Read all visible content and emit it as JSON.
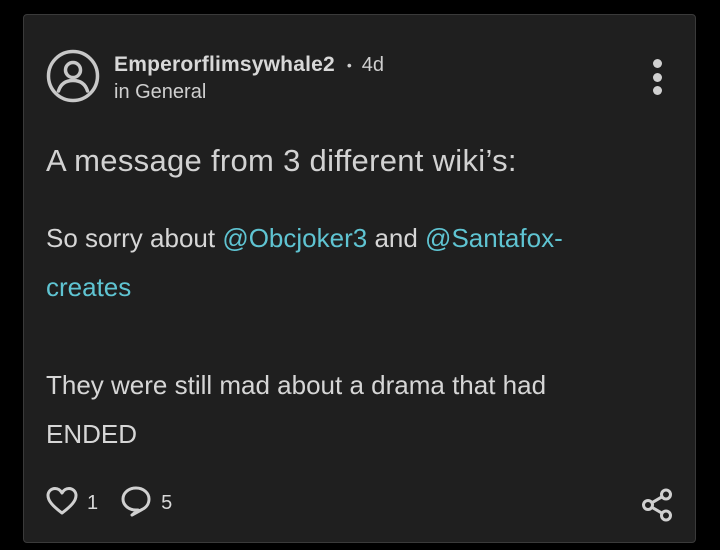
{
  "post": {
    "author": "Emperorflimsywhale2",
    "separator": "•",
    "time_ago": "4d",
    "community": "in General",
    "title": "A message from 3 different wiki’s:",
    "body": {
      "line1_prefix": "So sorry about ",
      "mention1": "@Obcjoker3",
      "line1_middle": " and ",
      "mention2_part1": "@Santafox-",
      "mention2_part2": "creates",
      "paragraph2_line1": "They were still mad about a drama that had",
      "paragraph2_line2": "ENDED"
    },
    "likes": "1",
    "comments": "5"
  },
  "icons": {
    "avatar": "user-circle-icon",
    "more": "more-vertical-icon",
    "like": "heart-icon",
    "comment": "comment-bubble-icon",
    "share": "share-icon"
  },
  "colors": {
    "background": "#000000",
    "card": "#1f1f1f",
    "text": "#d6d6d6",
    "mention": "#5fc4d2"
  }
}
